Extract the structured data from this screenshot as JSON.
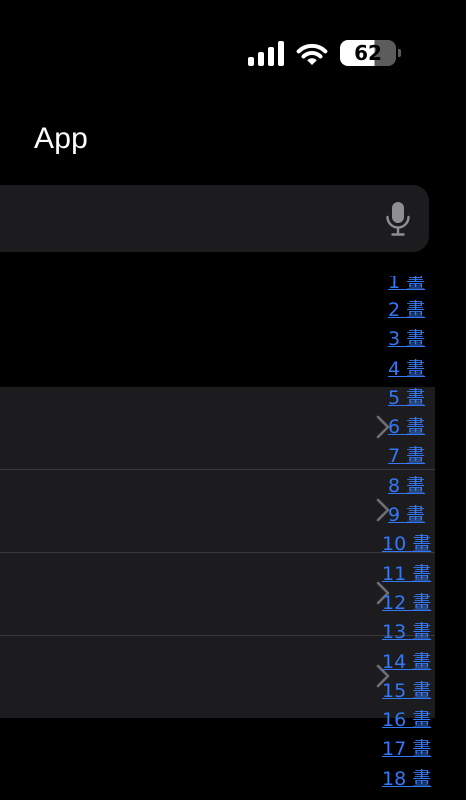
{
  "status_bar": {
    "battery_level": "62",
    "battery_fraction": 0.62,
    "signal_icon": "cellular-signal-icon",
    "wifi_icon": "wifi-icon"
  },
  "nav": {
    "title": "App"
  },
  "search": {
    "placeholder": "",
    "mic_icon": "microphone-icon"
  },
  "list": {
    "rows": [
      {
        "chevron_icon": "chevron-right-icon"
      },
      {
        "chevron_icon": "chevron-right-icon"
      },
      {
        "chevron_icon": "chevron-right-icon"
      },
      {
        "chevron_icon": "chevron-right-icon"
      }
    ]
  },
  "section_index": {
    "items": [
      "1 畫",
      "2 畫",
      "3 畫",
      "4 畫",
      "5 畫",
      "6 畫",
      "7 畫",
      "8 畫",
      "9 畫",
      "10 畫",
      "11 畫",
      "12 畫",
      "13 畫",
      "14 畫",
      "15 畫",
      "16 畫",
      "17 畫",
      "18 畫"
    ]
  },
  "colors": {
    "background": "#000000",
    "surface": "#1c1c1e",
    "separator": "#38383a",
    "accent": "#3478f6",
    "secondary_icon": "#8e8e93"
  }
}
